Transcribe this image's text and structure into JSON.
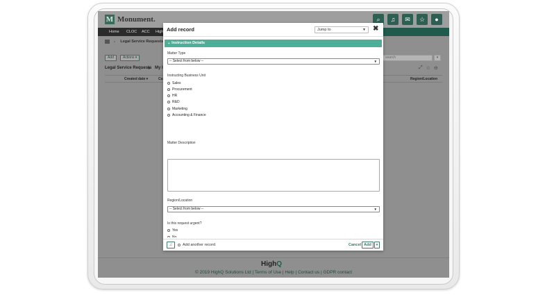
{
  "brand": {
    "name": "Monument.",
    "mark": "M"
  },
  "header_icons": [
    "search-icon",
    "bell-icon",
    "mail-icon",
    "star-icon",
    "user-icon"
  ],
  "nav": {
    "items": [
      "Home",
      "CLOC",
      "ACC",
      "High"
    ]
  },
  "breadcrumb": {
    "current": "Legal Service Requests ▾"
  },
  "page": {
    "add_label": "Add",
    "actions_label": "Actions ▾",
    "title": "Legal Service Requests",
    "title_caret": "▾",
    "view_label": "My I",
    "search_placeholder": "search",
    "table_headers": [
      "Created date ▾",
      "Cur",
      "Region/Location"
    ]
  },
  "modal": {
    "title": "Add record",
    "jump_to": "Jump to",
    "close": "✖",
    "section": "Instruction Details",
    "matter_type": {
      "label": "Matter Type",
      "value": "-- Select from below --"
    },
    "business_unit": {
      "label": "Instructing Business Unit",
      "options": [
        "Sales",
        "Procurement",
        "HR",
        "R&D",
        "Marketing",
        "Accounting & Finance"
      ]
    },
    "matter_description": {
      "label": "Matter Description",
      "value": ""
    },
    "region": {
      "label": "Region/Location",
      "value": "-- Select from below --"
    },
    "urgent": {
      "label": "Is this request urgent?",
      "options": [
        "Yes",
        "No"
      ]
    },
    "footer": {
      "add_another": "Add another record",
      "cancel": "Cancel",
      "add": "Add"
    }
  },
  "footer": {
    "logo_a": "High",
    "logo_b": "Q",
    "links": "© 2019 HighQ Solutions Ltd | Terms of Use | Help | Contact us | GDPR contact"
  }
}
